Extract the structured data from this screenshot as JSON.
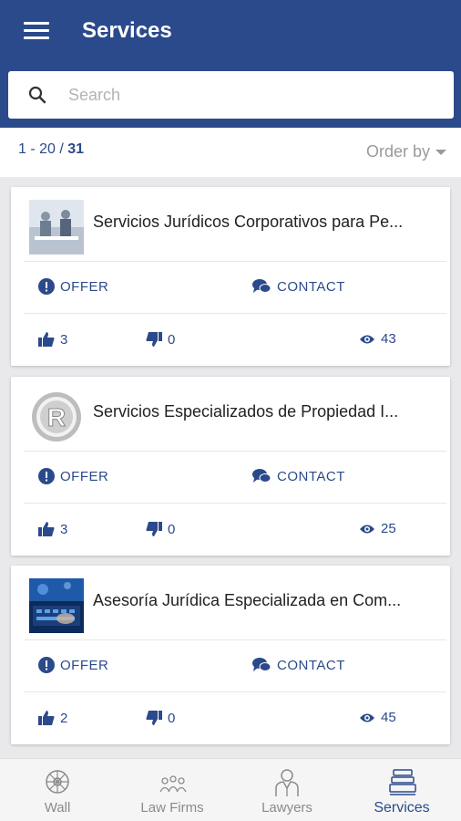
{
  "header": {
    "title": "Services"
  },
  "search": {
    "placeholder": "Search"
  },
  "pagination": {
    "range": "1 - 20 / ",
    "total": "31"
  },
  "order_by": {
    "label": "Order by"
  },
  "actions": {
    "offer_label": "OFFER",
    "contact_label": "CONTACT"
  },
  "cards": [
    {
      "title": "Servicios Jurídicos Corporativos para Pe...",
      "likes": "3",
      "dislikes": "0",
      "views": "43",
      "thumb_icon": "business-meeting-photo"
    },
    {
      "title": "Servicios Especializados de Propiedad I...",
      "likes": "3",
      "dislikes": "0",
      "views": "25",
      "thumb_icon": "registered-trademark-photo"
    },
    {
      "title": "Asesoría Jurídica Especializada en Com...",
      "likes": "2",
      "dislikes": "0",
      "views": "45",
      "thumb_icon": "digital-keyboard-photo"
    }
  ],
  "bottom_nav": {
    "items": [
      {
        "label": "Wall",
        "icon": "wall-icon"
      },
      {
        "label": "Law Firms",
        "icon": "law-firms-icon"
      },
      {
        "label": "Lawyers",
        "icon": "lawyers-icon"
      },
      {
        "label": "Services",
        "icon": "services-icon"
      }
    ],
    "active": "Services"
  },
  "colors": {
    "primary": "#2b4a8b",
    "background": "#e9e9ec",
    "muted": "#9a9a9a"
  }
}
